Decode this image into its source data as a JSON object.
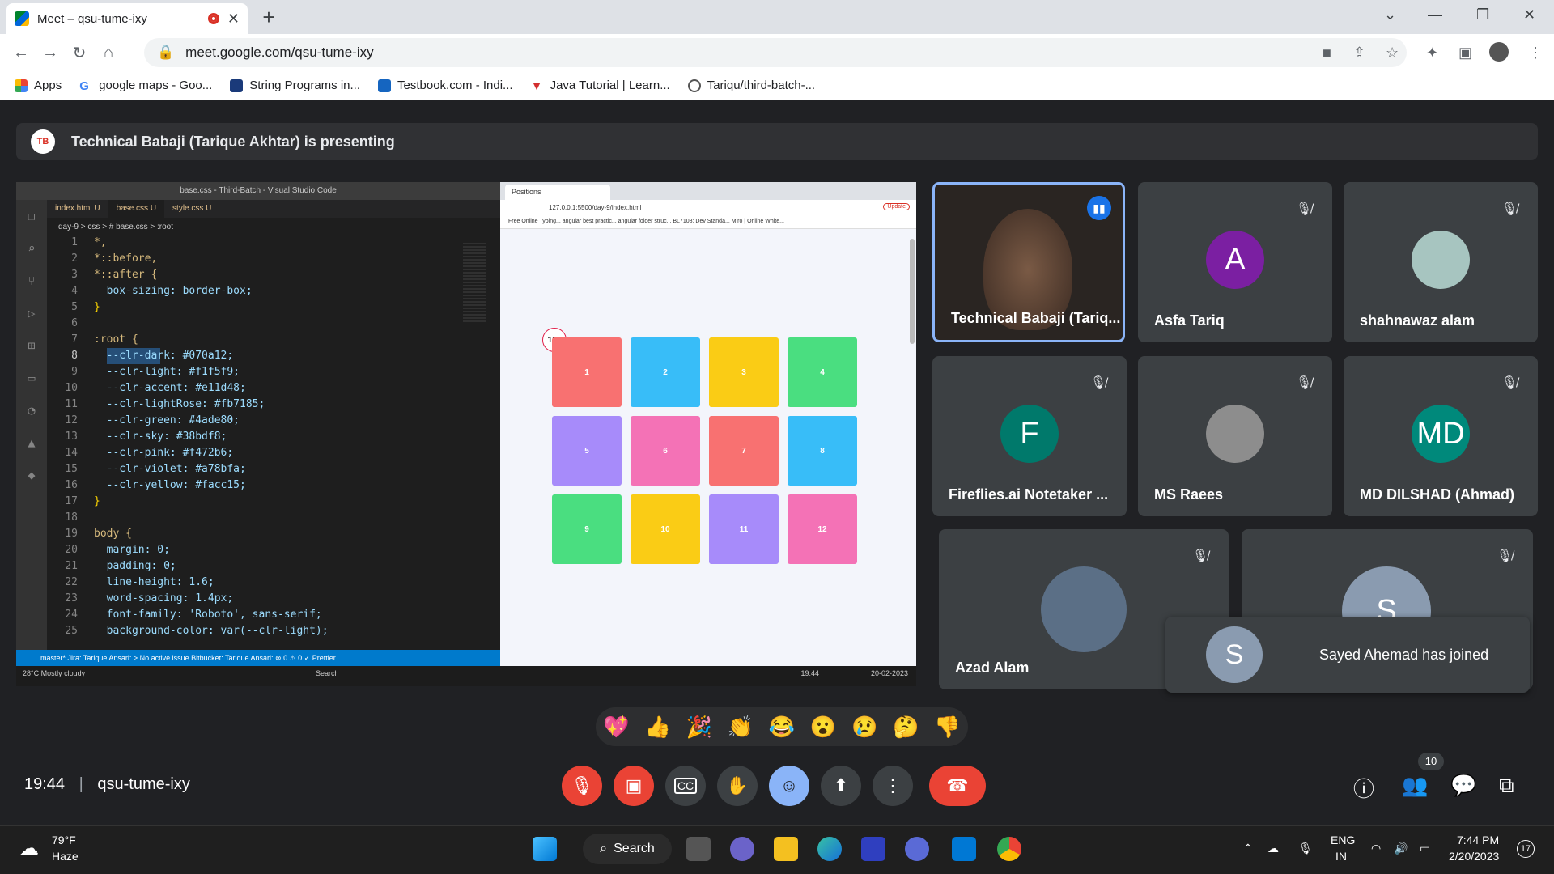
{
  "browser": {
    "tab_title": "Meet – qsu-tume-ixy",
    "url": "meet.google.com/qsu-tume-ixy",
    "bookmarks": [
      "Apps",
      "google maps - Goo...",
      "String Programs in...",
      "Testbook.com - Indi...",
      "Java Tutorial | Learn...",
      "Tariqu/third-batch-..."
    ]
  },
  "banner": {
    "logo": "TB",
    "text": "Technical Babaji (Tarique Akhtar) is presenting"
  },
  "vscode": {
    "title": "base.css - Third-Batch - Visual Studio Code",
    "tabs": [
      "index.html U",
      "base.css U",
      "style.css U"
    ],
    "breadcrumb": "day-9 > css > # base.css > :root",
    "lines": [
      {
        "n": "1",
        "t": "*,"
      },
      {
        "n": "2",
        "t": "*::before,"
      },
      {
        "n": "3",
        "t": "*::after {"
      },
      {
        "n": "4",
        "t": "  box-sizing: border-box;"
      },
      {
        "n": "5",
        "t": "}"
      },
      {
        "n": "6",
        "t": ""
      },
      {
        "n": "7",
        "t": ":root {"
      },
      {
        "n": "8",
        "t": "  --clr-dark: #070a12;"
      },
      {
        "n": "9",
        "t": "  --clr-light: #f1f5f9;"
      },
      {
        "n": "10",
        "t": "  --clr-accent: #e11d48;"
      },
      {
        "n": "11",
        "t": "  --clr-lightRose: #fb7185;"
      },
      {
        "n": "12",
        "t": "  --clr-green: #4ade80;"
      },
      {
        "n": "13",
        "t": "  --clr-sky: #38bdf8;"
      },
      {
        "n": "14",
        "t": "  --clr-pink: #f472b6;"
      },
      {
        "n": "15",
        "t": "  --clr-violet: #a78bfa;"
      },
      {
        "n": "16",
        "t": "  --clr-yellow: #facc15;"
      },
      {
        "n": "17",
        "t": "}"
      },
      {
        "n": "18",
        "t": ""
      },
      {
        "n": "19",
        "t": "body {"
      },
      {
        "n": "20",
        "t": "  margin: 0;"
      },
      {
        "n": "21",
        "t": "  padding: 0;"
      },
      {
        "n": "22",
        "t": "  line-height: 1.6;"
      },
      {
        "n": "23",
        "t": "  word-spacing: 1.4px;"
      },
      {
        "n": "24",
        "t": "  font-family: 'Roboto', sans-serif;"
      },
      {
        "n": "25",
        "t": "  background-color: var(--clr-light);"
      }
    ],
    "status": "master*   Jira: Tarique Ansari:   > No active issue   Bitbucket: Tarique Ansari:   ⊗ 0 ⚠ 0   ✓ Prettier"
  },
  "inner_browser": {
    "tab": "Positions",
    "url": "127.0.0.1:5500/day-9/index.html",
    "update": "Update",
    "bookmarks": "Free Online Typing...   angular best practic...   angular folder struc...   BL7108: Dev Standa...   Miro | Online White...",
    "circle": "100",
    "boxes": [
      {
        "label": "1",
        "color": "#f87171"
      },
      {
        "label": "2",
        "color": "#38bdf8"
      },
      {
        "label": "3",
        "color": "#facc15"
      },
      {
        "label": "4",
        "color": "#4ade80"
      },
      {
        "label": "5",
        "color": "#a78bfa"
      },
      {
        "label": "6",
        "color": "#f472b6"
      },
      {
        "label": "7",
        "color": "#f87171"
      },
      {
        "label": "8",
        "color": "#38bdf8"
      },
      {
        "label": "9",
        "color": "#4ade80"
      },
      {
        "label": "10",
        "color": "#facc15"
      },
      {
        "label": "11",
        "color": "#a78bfa"
      },
      {
        "label": "12",
        "color": "#f472b6"
      }
    ],
    "os_taskbar_weather": "28°C Mostly cloudy",
    "os_search": "Search",
    "os_time": "19:44",
    "os_date": "20-02-2023"
  },
  "participants": [
    {
      "name": "Technical Babaji (Tariq...",
      "initial": "",
      "avatar_color": "",
      "speaking": true
    },
    {
      "name": "Asfa Tariq",
      "initial": "A",
      "avatar_color": "#7b1fa2"
    },
    {
      "name": "shahnawaz alam",
      "initial": "",
      "avatar_color": "#a7c5c0"
    },
    {
      "name": "Fireflies.ai Notetaker ...",
      "initial": "F",
      "avatar_color": "#00796b"
    },
    {
      "name": "MS Raees",
      "initial": "",
      "avatar_color": "#8d8d8d"
    },
    {
      "name": "MD DILSHAD (Ahmad)",
      "initial": "MD",
      "avatar_color": "#00897b"
    },
    {
      "name": "Azad Alam",
      "initial": "",
      "avatar_color": "#5b6f86"
    },
    {
      "name": "",
      "initial": "S",
      "avatar_color": "#8a9bb0"
    }
  ],
  "toast": {
    "initial": "S",
    "text": "Sayed Ahemad has joined"
  },
  "reactions": [
    "💖",
    "👍",
    "🎉",
    "👏",
    "😂",
    "😮",
    "😢",
    "🤔",
    "👎"
  ],
  "meeting": {
    "time": "19:44",
    "code": "qsu-tume-ixy",
    "people_count": "10"
  },
  "windows": {
    "temp": "79°F",
    "weather": "Haze",
    "search": "Search",
    "lang1": "ENG",
    "lang2": "IN",
    "time": "7:44 PM",
    "date": "2/20/2023",
    "notif": "17"
  }
}
